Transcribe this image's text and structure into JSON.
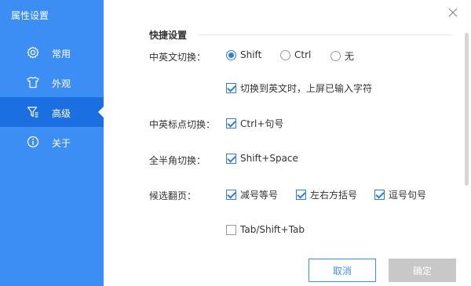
{
  "window": {
    "title": "属性设置"
  },
  "sidebar": {
    "items": [
      {
        "label": "常用",
        "icon": "gear-icon"
      },
      {
        "label": "外观",
        "icon": "shirt-icon"
      },
      {
        "label": "高级",
        "icon": "filter-icon",
        "active": true
      },
      {
        "label": "关于",
        "icon": "info-icon"
      }
    ]
  },
  "section": {
    "title": "快捷设置"
  },
  "settings": {
    "lang_switch": {
      "label": "中英文切换：",
      "options": [
        {
          "label": "Shift",
          "selected": true
        },
        {
          "label": "Ctrl",
          "selected": false
        },
        {
          "label": "无",
          "selected": false
        }
      ],
      "extra_checkbox": {
        "label": "切换到英文时，上屏已输入字符",
        "checked": true
      }
    },
    "punct_switch": {
      "label": "中英标点切换：",
      "checkbox": {
        "label": "Ctrl+句号",
        "checked": true
      }
    },
    "width_switch": {
      "label": "全半角切换：",
      "checkbox": {
        "label": "Shift+Space",
        "checked": true
      }
    },
    "page_turn": {
      "label": "候选翻页：",
      "checkboxes": [
        {
          "label": "减号等号",
          "checked": true
        },
        {
          "label": "左右方括号",
          "checked": true
        },
        {
          "label": "逗号句号",
          "checked": true
        },
        {
          "label": "Tab/Shift+Tab",
          "checked": false
        }
      ]
    }
  },
  "buttons": {
    "cancel": "取消",
    "ok": "确定"
  },
  "colors": {
    "sidebar": "#3d8ef4",
    "sidebar_active": "#1b6fe0",
    "accent": "#2f7de1",
    "disabled_button": "#c8c8c8"
  }
}
